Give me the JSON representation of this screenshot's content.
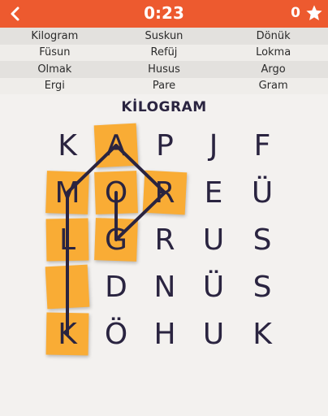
{
  "header": {
    "timer": "0:23",
    "score": "0",
    "back_icon": "chevron-left-icon",
    "star_icon": "star-icon",
    "bg_color": "#ed5a2f"
  },
  "word_list": {
    "rows": [
      [
        "Kilogram",
        "Suskun",
        "Dönük"
      ],
      [
        "Füsun",
        "Refüj",
        "Lokma"
      ],
      [
        "Olmak",
        "Husus",
        "Argo"
      ],
      [
        "Ergi",
        "Pare",
        "Gram"
      ]
    ]
  },
  "current_word": "KİLOGRAM",
  "grid": {
    "rows": [
      [
        "K",
        "A",
        "P",
        "J",
        "F"
      ],
      [
        "M",
        "O",
        "R",
        "E",
        "Ü"
      ],
      [
        "L",
        "G",
        "R",
        "U",
        "S"
      ],
      [
        "İ",
        "D",
        "N",
        "Ü",
        "S"
      ],
      [
        "K",
        "Ö",
        "H",
        "U",
        "K"
      ]
    ],
    "highlight_color": "#f9ac35",
    "highlighted_cells": [
      [
        0,
        1
      ],
      [
        1,
        0
      ],
      [
        1,
        1
      ],
      [
        1,
        2
      ],
      [
        2,
        0
      ],
      [
        2,
        1
      ],
      [
        3,
        0
      ],
      [
        4,
        0
      ]
    ],
    "path": [
      [
        4,
        0
      ],
      [
        3,
        0
      ],
      [
        2,
        0
      ],
      [
        1,
        0
      ],
      [
        0,
        1
      ],
      [
        1,
        2
      ],
      [
        2,
        1
      ],
      [
        1,
        1
      ]
    ]
  }
}
